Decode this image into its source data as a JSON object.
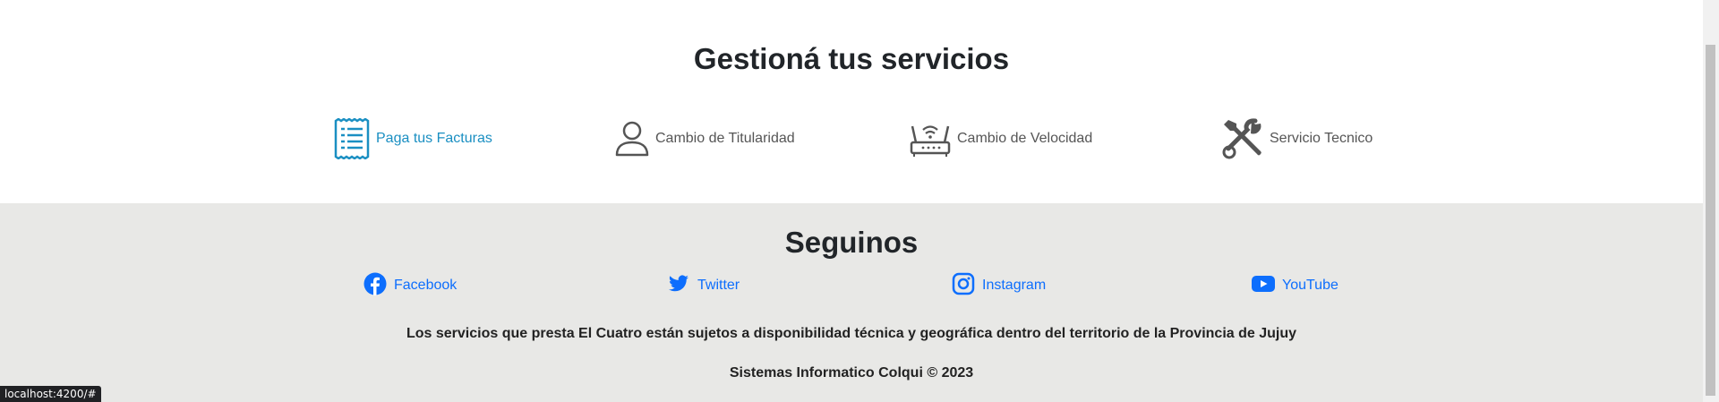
{
  "services": {
    "title": "Gestioná tus servicios",
    "items": [
      {
        "label": "Paga tus Facturas",
        "icon": "receipt-icon"
      },
      {
        "label": "Cambio de Titularidad",
        "icon": "person-icon"
      },
      {
        "label": "Cambio de Velocidad",
        "icon": "router-icon"
      },
      {
        "label": "Servicio Tecnico",
        "icon": "tools-icon"
      }
    ]
  },
  "footer": {
    "title": "Seguinos",
    "social": [
      {
        "label": "Facebook",
        "icon": "facebook-icon"
      },
      {
        "label": "Twitter",
        "icon": "twitter-icon"
      },
      {
        "label": "Instagram",
        "icon": "instagram-icon"
      },
      {
        "label": "YouTube",
        "icon": "youtube-icon"
      }
    ],
    "disclaimer": "Los servicios que presta El Cuatro están sujetos a disponibilidad técnica y geográfica dentro del territorio de la Provincia de Jujuy",
    "copyright": "Sistemas Informatico Colqui © 2023"
  },
  "status_bar": {
    "url": "localhost:4200/#"
  },
  "colors": {
    "primary": "#1a8fc2",
    "link": "#0d6efd",
    "footer_bg": "#e8e8e6"
  }
}
